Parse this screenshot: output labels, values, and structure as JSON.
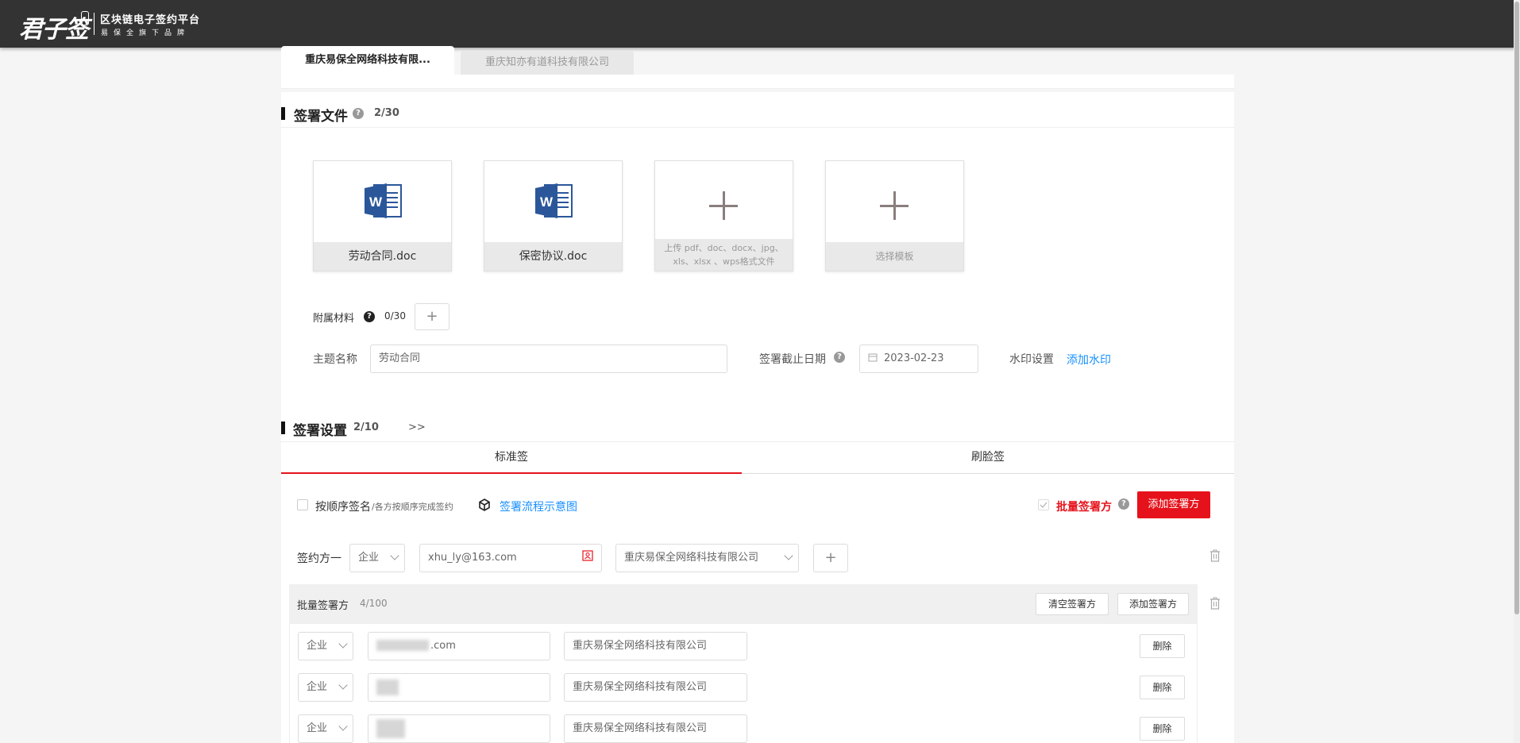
{
  "header": {
    "logo": "君子签",
    "platform": "区块链电子签约平台",
    "tagline": "易保全旗下品牌"
  },
  "company_tabs": [
    "重庆易保全网络科技有限...",
    "重庆知亦有道科技有限公司"
  ],
  "sign_files": {
    "title": "签署文件",
    "count": "2/30",
    "files": [
      "劳动合同.doc",
      "保密协议.doc"
    ],
    "upload_hint": "上传 pdf、doc、docx、jpg、xls、xlsx 、wps格式文件",
    "template_label": "选择模板"
  },
  "attachments": {
    "label": "附属材料",
    "count": "0/30"
  },
  "subject": {
    "label": "主题名称",
    "value": "劳动合同"
  },
  "deadline": {
    "label": "签署截止日期",
    "value": "2023-02-23"
  },
  "watermark": {
    "label": "水印设置",
    "link": "添加水印"
  },
  "sign_settings": {
    "title": "签署设置",
    "count": "2/10",
    "expand": ">>",
    "tabs": [
      "标准签",
      "刷脸签"
    ],
    "sequential_label": "按顺序签名",
    "sequential_hint": "/各方按顺序完成签约",
    "flow_link": "签署流程示意图",
    "batch_label": "批量签署方",
    "add_signer": "添加签署方"
  },
  "party_one": {
    "label": "签约方一",
    "type": "企业",
    "email": "xhu_ly@163.com",
    "company": "重庆易保全网络科技有限公司"
  },
  "batch": {
    "title": "批量签署方",
    "count": "4/100",
    "clear_button": "清空签署方",
    "add_button": "添加签署方",
    "rows": [
      {
        "type": "企业",
        "contact": ".com",
        "company": "重庆易保全网络科技有限公司",
        "action": "删除"
      },
      {
        "type": "企业",
        "contact": "",
        "company": "重庆易保全网络科技有限公司",
        "action": "删除"
      },
      {
        "type": "企业",
        "contact": "",
        "company": "重庆易保全网络科技有限公司",
        "action": "删除"
      }
    ]
  },
  "colors": {
    "topbar": "#333333",
    "accent_red": "#e6121b",
    "link_blue": "#1890ff",
    "word_blue": "#2b579a"
  }
}
